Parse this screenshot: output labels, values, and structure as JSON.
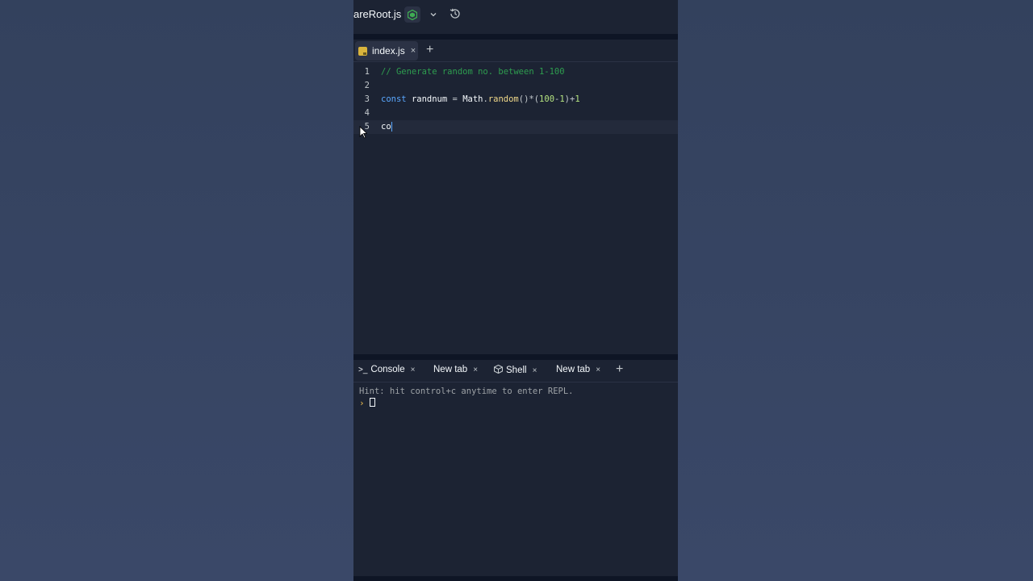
{
  "topbar": {
    "file_title": "areRoot.js",
    "node_icon": "nodejs-icon",
    "chevron_icon": "chevron-down-icon",
    "history_icon": "history-icon"
  },
  "editor_tabs": {
    "active": {
      "label": "index.js",
      "close": "×"
    },
    "add": "+"
  },
  "code_lines": [
    {
      "num": "1",
      "text": "// Generate random no. between 1-100"
    },
    {
      "num": "2",
      "text": ""
    },
    {
      "num": "3",
      "text": "const randnum = Math.random()*(100-1)+1"
    },
    {
      "num": "4",
      "text": ""
    },
    {
      "num": "5",
      "text": "co"
    }
  ],
  "console_tabs": [
    {
      "label": "Console",
      "icon": ">_",
      "close": "×"
    },
    {
      "label": "New tab",
      "close": "×"
    },
    {
      "label": "Shell",
      "close": "×"
    },
    {
      "label": "New tab",
      "close": "×"
    }
  ],
  "console_add": "+",
  "console": {
    "hint": "Hint: hit control+c anytime to enter REPL.",
    "prompt": "›"
  },
  "colors": {
    "background": "#33415d",
    "editor_bg": "#1c2333",
    "comment": "#2e9d4f",
    "keyword": "#5aa8ff",
    "function": "#f1d98a",
    "number": "#b4e27f"
  }
}
